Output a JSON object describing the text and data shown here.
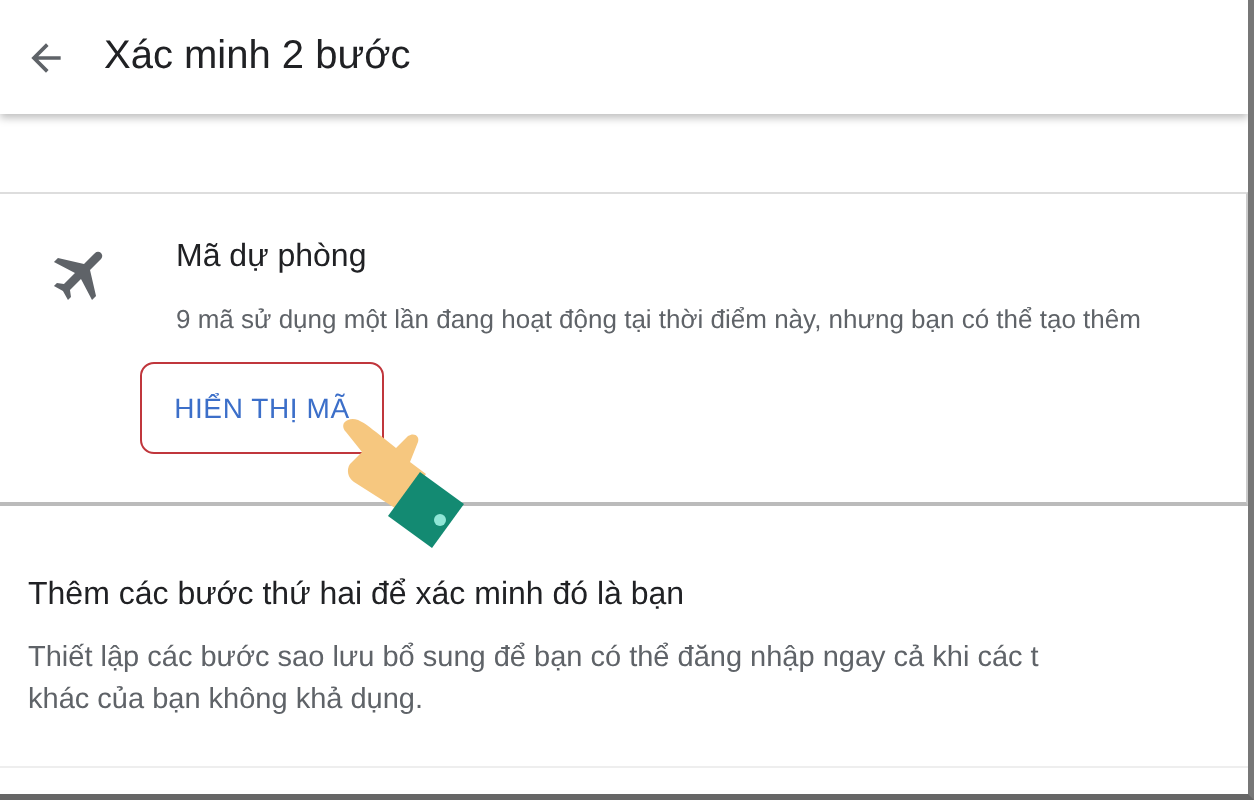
{
  "header": {
    "title": "Xác minh 2 bước"
  },
  "backup_codes": {
    "title": "Mã dự phòng",
    "description": "9 mã sử dụng một lần đang hoạt động tại thời điểm này, nhưng bạn có thể tạo thêm",
    "button": "HIỂN THỊ MÃ"
  },
  "section": {
    "title": "Thêm các bước thứ hai để xác minh đó là bạn",
    "lines": [
      "Thiết lập các bước sao lưu bổ sung để bạn có thể đăng nhập ngay cả khi các t",
      "khác của bạn không khả dụng."
    ]
  }
}
